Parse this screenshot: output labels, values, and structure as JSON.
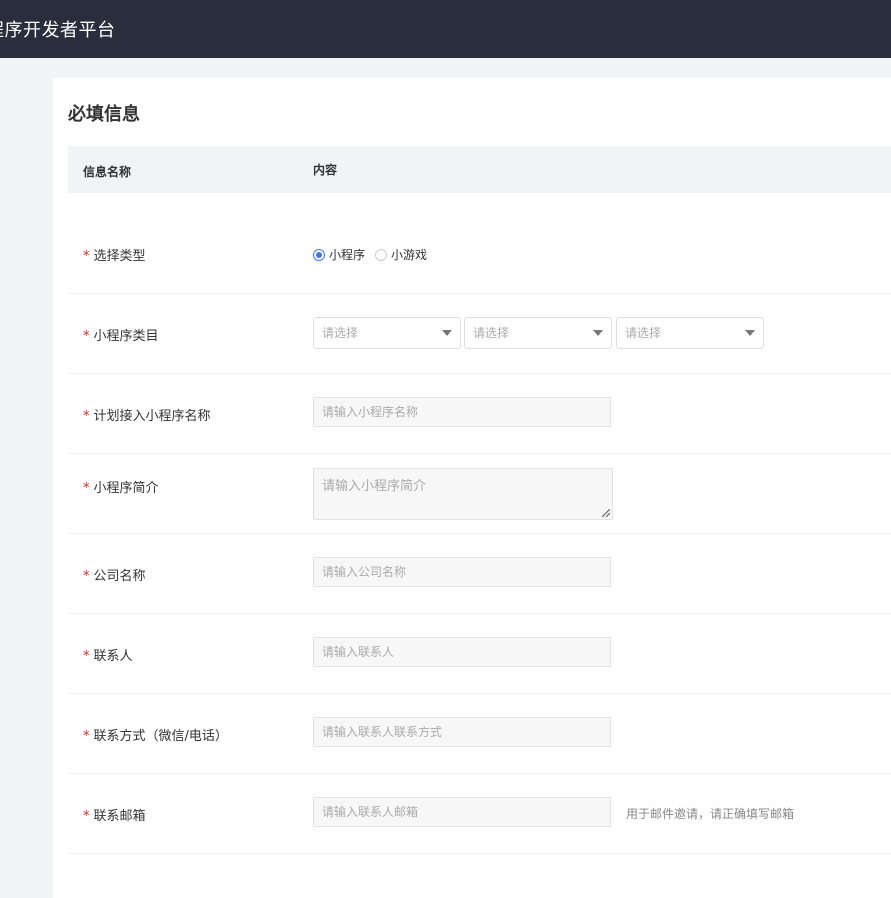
{
  "header": {
    "title": "程序开发者平台"
  },
  "section": {
    "title": "必填信息"
  },
  "table": {
    "col_name": "信息名称",
    "col_content": "内容"
  },
  "required_mark": "*",
  "fields": {
    "type": {
      "label": "选择类型",
      "options": [
        "小程序",
        "小游戏"
      ],
      "selected": "小程序"
    },
    "category": {
      "label": "小程序类目",
      "selects": [
        "请选择",
        "请选择",
        "请选择"
      ]
    },
    "app_name": {
      "label": "计划接入小程序名称",
      "placeholder": "请输入小程序名称"
    },
    "intro": {
      "label": "小程序简介",
      "placeholder": "请输入小程序简介"
    },
    "company": {
      "label": "公司名称",
      "placeholder": "请输入公司名称"
    },
    "contact": {
      "label": "联系人",
      "placeholder": "请输入联系人"
    },
    "contact_method": {
      "label": "联系方式（微信/电话）",
      "placeholder": "请输入联系人联系方式"
    },
    "email": {
      "label": "联系邮箱",
      "placeholder": "请输入联系人邮箱",
      "hint": "用于邮件邀请，请正确填写邮箱"
    }
  },
  "colors": {
    "accent": "#3f7ae6",
    "required": "#e2231a",
    "topbar": "#282e3b"
  }
}
